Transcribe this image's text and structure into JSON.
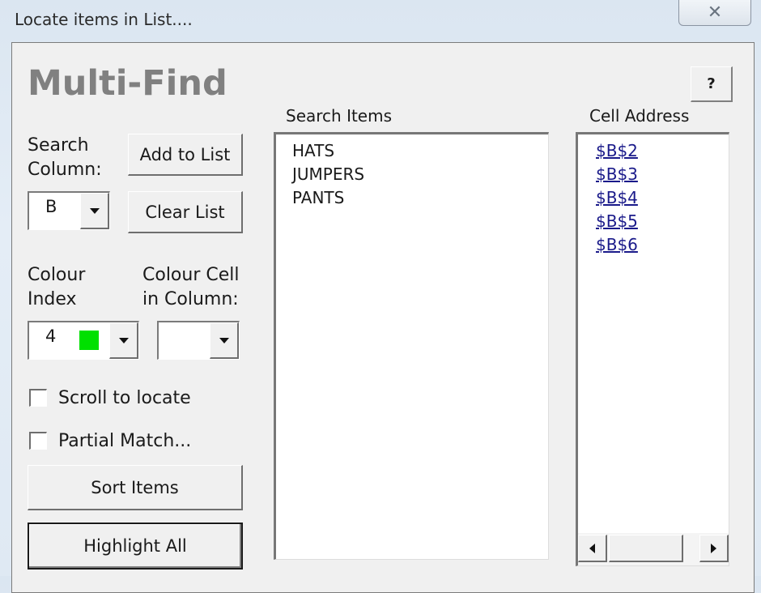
{
  "window": {
    "title": "Locate items in List....",
    "close_icon": "close-x-icon"
  },
  "heading": "Multi-Find",
  "help_button": "?",
  "search_column": {
    "label_line1": "Search",
    "label_line2": "Column:",
    "value": "B"
  },
  "buttons": {
    "add_to_list": "Add to List",
    "clear_list": "Clear List",
    "sort_items": "Sort Items",
    "highlight_all": "Highlight All"
  },
  "colour_index": {
    "label_line1": "Colour",
    "label_line2": "Index",
    "value": "4",
    "swatch_color": "#00e000"
  },
  "colour_cell": {
    "label_line1": "Colour Cell",
    "label_line2": "in Column:",
    "value": ""
  },
  "checkboxes": [
    {
      "label": "Scroll to locate",
      "checked": false
    },
    {
      "label": "Partial Match...",
      "checked": false
    }
  ],
  "search_items": {
    "header": "Search Items",
    "items": [
      "HATS",
      "JUMPERS",
      "PANTS"
    ]
  },
  "cell_address": {
    "header": "Cell Address",
    "items": [
      "$B$2",
      "$B$3",
      "$B$4",
      "$B$5",
      "$B$6"
    ]
  }
}
